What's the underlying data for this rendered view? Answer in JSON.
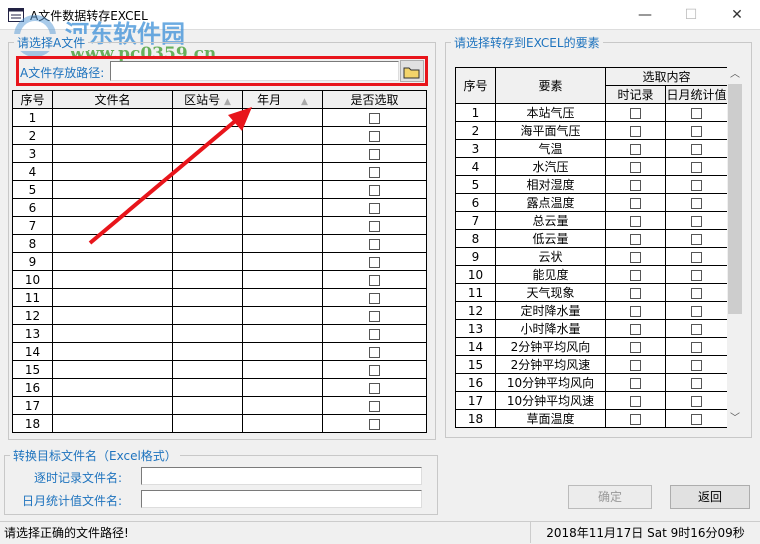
{
  "window": {
    "title": "A文件数据转存EXCEL",
    "minimize": "—",
    "maximize": "☐",
    "close": "✕"
  },
  "watermark": {
    "name": "河东软件园",
    "url": "www.pc0359.cn"
  },
  "file_group": {
    "title": "请选择A文件",
    "path_label": "A文件存放路径:",
    "path_value": "",
    "browse_icon": "folder-icon"
  },
  "file_table": {
    "columns": [
      "序号",
      "文件名",
      "区站号",
      "年月",
      "是否选取"
    ],
    "rows": [
      "1",
      "2",
      "3",
      "4",
      "5",
      "6",
      "7",
      "8",
      "9",
      "10",
      "11",
      "12",
      "13",
      "14",
      "15",
      "16",
      "17",
      "18"
    ]
  },
  "element_group": {
    "title": "请选择转存到EXCEL的要素"
  },
  "element_table": {
    "col_index": "序号",
    "col_element": "要素",
    "col_select": "选取内容",
    "col_hourly": "时记录",
    "col_daily": "日月统计值",
    "rows": [
      {
        "n": "1",
        "name": "本站气压"
      },
      {
        "n": "2",
        "name": "海平面气压"
      },
      {
        "n": "3",
        "name": "气温"
      },
      {
        "n": "4",
        "name": "水汽压"
      },
      {
        "n": "5",
        "name": "相对湿度"
      },
      {
        "n": "6",
        "name": "露点温度"
      },
      {
        "n": "7",
        "name": "总云量"
      },
      {
        "n": "8",
        "name": "低云量"
      },
      {
        "n": "9",
        "name": "云状"
      },
      {
        "n": "10",
        "name": "能见度"
      },
      {
        "n": "11",
        "name": "天气现象"
      },
      {
        "n": "12",
        "name": "定时降水量"
      },
      {
        "n": "13",
        "name": "小时降水量"
      },
      {
        "n": "14",
        "name": "2分钟平均风向"
      },
      {
        "n": "15",
        "name": "2分钟平均风速"
      },
      {
        "n": "16",
        "name": "10分钟平均风向"
      },
      {
        "n": "17",
        "name": "10分钟平均风速"
      },
      {
        "n": "18",
        "name": "草面温度"
      }
    ]
  },
  "target_group": {
    "title": "转换目标文件名（Excel格式）",
    "hourly_label": "逐时记录文件名:",
    "hourly_value": "",
    "daily_label": "日月统计值文件名:",
    "daily_value": ""
  },
  "buttons": {
    "ok": "确定",
    "back": "返回"
  },
  "status": {
    "message": "请选择正确的文件路径!",
    "datetime": "2018年11月17日  Sat 9时16分09秒"
  },
  "colors": {
    "accent": "#1e73be",
    "annotation": "#e8151b"
  }
}
